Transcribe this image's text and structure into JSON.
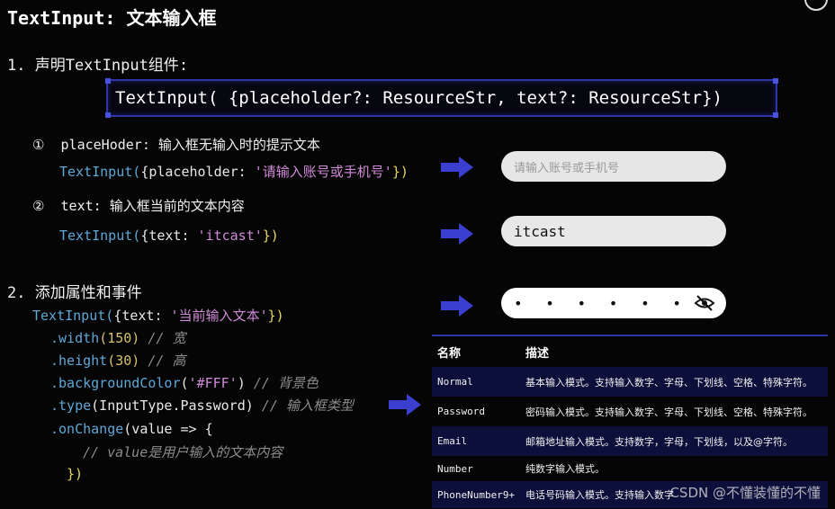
{
  "title": "TextInput: 文本输入框",
  "section1": "1. 声明TextInput组件:",
  "signature": "TextInput( {placeholder?: ResourceStr, text?: ResourceStr})",
  "items": {
    "placeholder": {
      "num": "①",
      "label": "placeHoder: 输入框无输入时的提示文本",
      "code_fn": "TextInput(",
      "code_mid": "{placeholder: ",
      "code_str": "'请输入账号或手机号'",
      "code_end": "})",
      "demo_placeholder": "请输入账号或手机号"
    },
    "text": {
      "num": "②",
      "label": "text: 输入框当前的文本内容",
      "code_fn": "TextInput(",
      "code_mid": "{text: ",
      "code_str": "'itcast'",
      "code_end": "})",
      "demo_value": "itcast"
    }
  },
  "section2": "2. 添加属性和事件",
  "code2": {
    "l1_fn": "TextInput(",
    "l1_mid": "{text: ",
    "l1_str": "'当前输入文本'",
    "l1_end": "})",
    "l2_fn": ".width",
    "l2_num": "(150)",
    "l2_com": " // 宽",
    "l3_fn": ".height",
    "l3_num": "(30)",
    "l3_com": " // 高",
    "l4_fn": ".backgroundColor",
    "l4_open": "(",
    "l4_str": "'#FFF'",
    "l4_close": ")",
    "l4_com": " // 背景色",
    "l5_fn": ".type",
    "l5_arg": "(InputType.Password)",
    "l5_com": " // 输入框类型",
    "l6_fn": ".onChange",
    "l6_arg": "(value => {",
    "l7_com": "// value是用户输入的文本内容",
    "l8": "})"
  },
  "password_demo": "• • • • • •",
  "table": {
    "headers": [
      "名称",
      "描述"
    ],
    "rows": [
      [
        "Normal",
        "基本输入模式。支持输入数字、字母、下划线、空格、特殊字符。"
      ],
      [
        "Password",
        "密码输入模式。支持输入数字、字母、下划线、空格、特殊字符。"
      ],
      [
        "Email",
        "邮箱地址输入模式。支持数字，字母，下划线，以及@字符。"
      ],
      [
        "Number",
        "纯数字输入模式。"
      ],
      [
        "PhoneNumber9+",
        "电话号码输入模式。支持输入数字"
      ]
    ]
  },
  "watermark": "CSDN @不懂装懂的不懂",
  "colors": {
    "accent": "#2f35a8",
    "arrow": "#3a3fd0",
    "code_fn": "#5fa8d8",
    "code_str": "#d08ad8"
  }
}
